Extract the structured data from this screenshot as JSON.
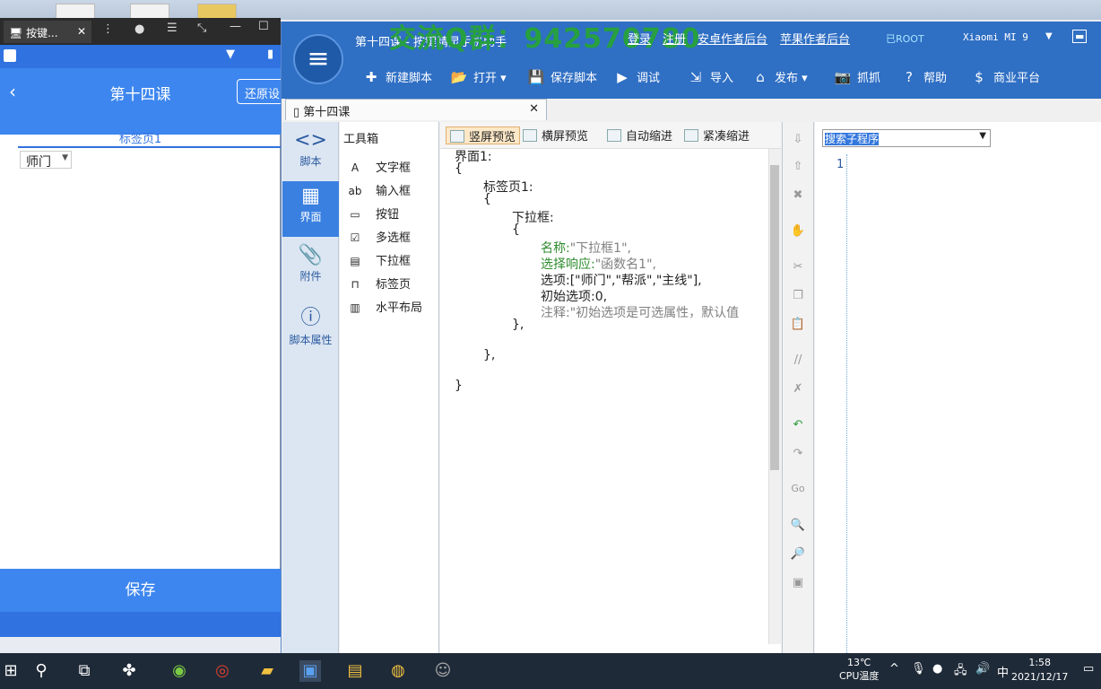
{
  "emulator": {
    "tab_title": "按键...",
    "header_title": "第十四课",
    "restore_button": "还原设",
    "tab_label": "标签页1",
    "dropdown_value": "师门",
    "save_button": "保存"
  },
  "ide": {
    "window_title": "第十四课 - 按键精灵手机助手",
    "watermark": "交流Q群：942570780",
    "links": {
      "login": "登录",
      "register": "注册",
      "android_author": "安卓作者后台",
      "apple_author": "苹果作者后台"
    },
    "root_badge": "已ROOT",
    "device": "Xiaomi MI 9",
    "toolbar": {
      "new_script": "新建脚本",
      "open": "打开",
      "save_script": "保存脚本",
      "debug": "调试",
      "import": "导入",
      "publish": "发布",
      "capture": "抓抓",
      "help": "帮助",
      "business": "商业平台"
    },
    "doc_tab": "第十四课",
    "nav": {
      "script": "脚本",
      "ui": "界面",
      "attachment": "附件",
      "properties": "脚本属性"
    },
    "toolbox": {
      "header": "工具箱",
      "items": [
        "文字框",
        "输入框",
        "按钮",
        "多选框",
        "下拉框",
        "标签页",
        "水平布局"
      ]
    },
    "editor_toolbar": {
      "portrait_preview": "竖屏预览",
      "landscape_preview": "横屏预览",
      "auto_indent": "自动缩进",
      "compact_indent": "紧凑缩进"
    },
    "code": {
      "l1": "界面1:",
      "l2": "{",
      "l3": "标签页1:",
      "l4": "{",
      "l5": "下拉框:",
      "l6": "{",
      "l7_key": "名称:",
      "l7_val": "\"下拉框1\",",
      "l8_key": "选择响应:",
      "l8_val": "\"函数名1\",",
      "l9": "选项:[\"师门\",\"帮派\",\"主线\"],",
      "l10": "初始选项:0,",
      "l11": "注释:\"初始选项是可选属性，默认值",
      "l12": "},",
      "l13": "},",
      "l14": "}"
    },
    "sub_search": "搜索子程序",
    "sub_line": "1"
  },
  "taskbar": {
    "temp": "13℃",
    "temp_label": "CPU温度",
    "ime": "中",
    "time": "1:58",
    "date": "2021/12/17"
  }
}
